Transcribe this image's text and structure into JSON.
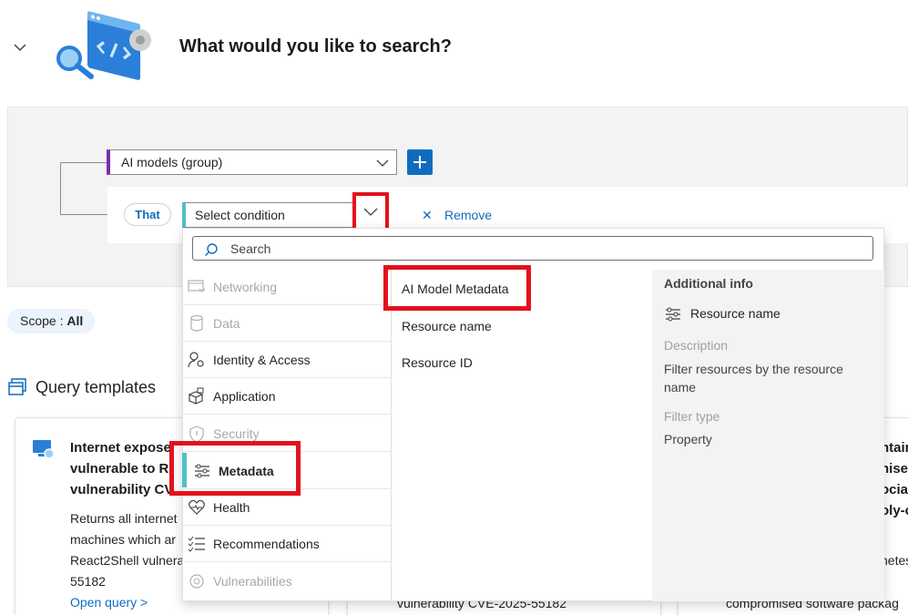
{
  "header": {
    "title": "What would you like to search?",
    "collapse_icon": "chevron-down-icon",
    "hero_icon": "search-code-illustration"
  },
  "builder": {
    "group_select_value": "AI models (group)",
    "add_icon": "plus-icon",
    "connector_label": "That",
    "condition_placeholder": "Select condition",
    "remove_label": "Remove",
    "remove_icon": "close-icon"
  },
  "scope": {
    "label": "Scope : ",
    "value": "All"
  },
  "templates": {
    "title": "Query templates",
    "cards": [
      {
        "title_lines": [
          "Internet expose",
          "vulnerable to R",
          "vulnerability CV"
        ],
        "desc_lines": [
          "Returns all internet",
          "machines which ar",
          "React2Shell vulnera",
          "55182"
        ],
        "link": "Open query >"
      },
      {
        "bottom_text": "vulnerability CVE-2025-55182"
      },
      {
        "title_lines": [
          "ntain",
          "nised",
          "ociate",
          "oly-c"
        ],
        "desc_lines": [
          "netes"
        ],
        "bottom_text": "compromised software packag"
      }
    ]
  },
  "dropdown": {
    "search_placeholder": "Search",
    "categories": [
      {
        "label": "Networking",
        "icon": "network-icon",
        "disabled": true
      },
      {
        "label": "Data",
        "icon": "database-icon",
        "disabled": true
      },
      {
        "label": "Identity & Access",
        "icon": "people-key-icon",
        "disabled": false
      },
      {
        "label": "Application",
        "icon": "app-boxes-icon",
        "disabled": false
      },
      {
        "label": "Security",
        "icon": "shield-icon",
        "disabled": true
      },
      {
        "label": "Metadata",
        "icon": "sliders-icon",
        "disabled": false,
        "selected": true
      },
      {
        "label": "Health",
        "icon": "heart-pulse-icon",
        "disabled": false
      },
      {
        "label": "Recommendations",
        "icon": "checklist-icon",
        "disabled": false
      },
      {
        "label": "Vulnerabilities",
        "icon": "bug-icon",
        "disabled": true
      }
    ],
    "options": [
      "AI Model Metadata",
      "Resource name",
      "Resource ID"
    ],
    "info": {
      "title": "Additional info",
      "name": "Resource name",
      "description_label": "Description",
      "description_lines": [
        "Filter resources by the resource",
        "name"
      ],
      "filter_type_label": "Filter type",
      "filter_type_value": "Property"
    }
  },
  "colors": {
    "accent": "#0f6cbd",
    "highlight": "#e3111c",
    "group_bar": "#7b2fa8",
    "condition_bar": "#4fc0c8"
  }
}
